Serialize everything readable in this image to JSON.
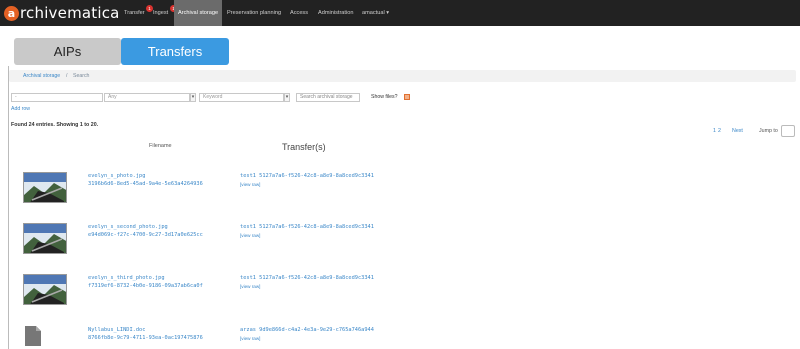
{
  "app": {
    "logo_letter": "a",
    "logo_text": "rchivematica"
  },
  "nav": {
    "items": [
      {
        "label": "Transfer",
        "badge": "1"
      },
      {
        "label": "Ingest",
        "badge": "1"
      },
      {
        "label": "Archival storage"
      },
      {
        "label": "Preservation planning"
      },
      {
        "label": "Access"
      },
      {
        "label": "Administration"
      },
      {
        "label": "amactual ▾"
      }
    ]
  },
  "tabs": {
    "aips": "AIPs",
    "transfers": "Transfers"
  },
  "breadcrumb": {
    "items": [
      "Archival storage",
      "/",
      "Search"
    ]
  },
  "search": {
    "query_value": "-",
    "field_value": "Any",
    "type_value": "Keyword",
    "storage_placeholder": "Search archival storage",
    "show_files_label": "Show files?",
    "add_row_label": "Add row"
  },
  "results": {
    "summary": "Found 24 entries. Showing 1 to 20.",
    "pages": [
      "1",
      "2"
    ],
    "next_label": "Next",
    "jump_label": "Jump to"
  },
  "table": {
    "col_name": "Filename",
    "col_transfer": "Transfer(s)",
    "view_raw_label": "[view raw]",
    "rows": [
      {
        "filename": "evelyn_s_photo.jpg",
        "uuid": "3196b6d6-8ed5-45ad-9a4e-5e63a4264936",
        "transfer": "test1 5127a7a6-f526-42c8-a8e9-8a8ced9c3341"
      },
      {
        "filename": "evelyn_s_second_photo.jpg",
        "uuid": "e94d069c-f27c-4700-9c27-3d17a0e625cc",
        "transfer": "test1 5127a7a6-f526-42c8-a8e9-8a8ced9c3341"
      },
      {
        "filename": "evelyn_s_third_photo.jpg",
        "uuid": "f7319ef6-8732-4b0e-9186-09a37ab6ca0f",
        "transfer": "test1 5127a7a6-f526-42c8-a8e9-8a8ced9c3341"
      },
      {
        "filename": "Nyllabus_LINDI.doc",
        "uuid": "8766fb8e-9c79-4711-93ea-0ac197475876",
        "transfer": "arzas 9d9e866d-c4a2-4e3a-9e29-c765a746a944"
      }
    ]
  },
  "colors": {
    "navbar": "#222222",
    "logo_orange": "#e46124",
    "tab_active": "#3b9ae1",
    "tab_inactive": "#c9c9c9",
    "link": "#3a87c8"
  }
}
